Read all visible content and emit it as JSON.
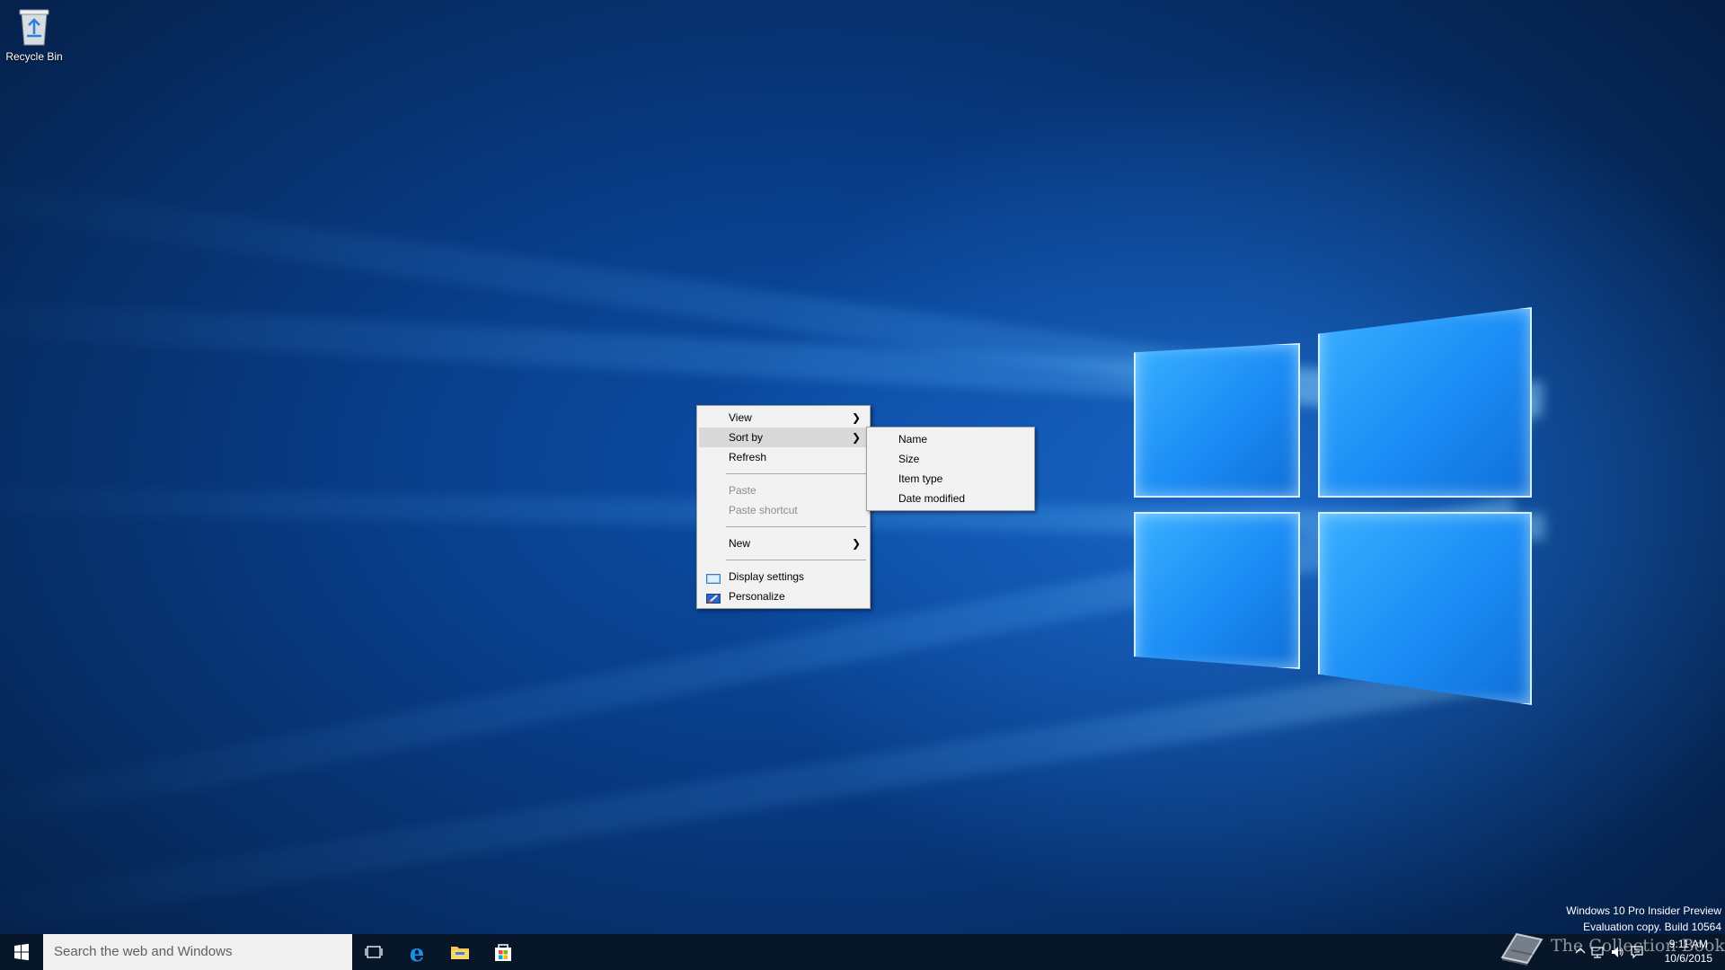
{
  "desktop": {
    "recycle_bin_label": "Recycle Bin",
    "build_watermark": {
      "line1": "Windows 10 Pro Insider Preview",
      "line2": "Evaluation copy. Build 10564"
    },
    "site_watermark": "The Collection Book"
  },
  "context_menu": {
    "items": [
      {
        "label": "View",
        "has_submenu": true
      },
      {
        "label": "Sort by",
        "has_submenu": true,
        "highlighted": true
      },
      {
        "label": "Refresh"
      },
      {
        "label": "Paste",
        "disabled": true
      },
      {
        "label": "Paste shortcut",
        "disabled": true
      },
      {
        "label": "New",
        "has_submenu": true
      },
      {
        "label": "Display settings",
        "icon": "display-settings-icon"
      },
      {
        "label": "Personalize",
        "icon": "personalize-icon"
      }
    ],
    "sort_by_submenu": {
      "items": [
        "Name",
        "Size",
        "Item type",
        "Date modified"
      ]
    }
  },
  "taskbar": {
    "search_placeholder": "Search the web and Windows",
    "pinned": [
      "task-view-icon",
      "edge-icon",
      "file-explorer-icon",
      "store-icon"
    ],
    "clock": {
      "time": "9:11 AM",
      "date": "10/6/2015"
    },
    "tray_icons": [
      "chevron-up-icon",
      "network-icon",
      "volume-icon",
      "action-center-icon"
    ]
  },
  "colors": {
    "taskbar_bg": "#071629",
    "menu_bg": "#f2f2f2",
    "menu_hover": "#d9d9d9",
    "wallpaper_accent": "#1b8cf5"
  }
}
